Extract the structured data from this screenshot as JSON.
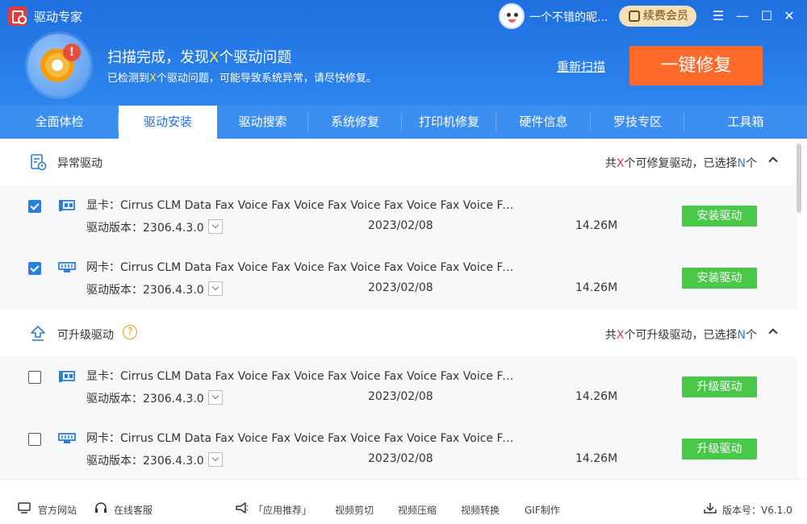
{
  "app": {
    "title": "驱动专家"
  },
  "user": {
    "name": "一个不错的昵...",
    "renew_label": "续费会员"
  },
  "window_controls": {
    "menu": "☰",
    "minimize": "—",
    "maximize": "☐",
    "close": "✕"
  },
  "scan": {
    "title_pre": "扫描完成，发现",
    "title_count": "X",
    "title_post": "个驱动问题",
    "sub_pre": "已检测到",
    "sub_count": "X",
    "sub_post": "个驱动问题，可能导致系统异常，请尽快修复。",
    "rescan_label": "重新扫描",
    "fix_label": "一键修复"
  },
  "tabs": [
    {
      "label": "全面体检"
    },
    {
      "label": "驱动安装"
    },
    {
      "label": "驱动搜索"
    },
    {
      "label": "系统修复"
    },
    {
      "label": "打印机修复"
    },
    {
      "label": "硬件信息"
    },
    {
      "label": "罗技专区"
    },
    {
      "label": "工具箱"
    }
  ],
  "sections": {
    "abnormal": {
      "title": "异常驱动",
      "summary_pre": "共",
      "summary_count": "X",
      "summary_mid": "个可修复驱动，已选择",
      "summary_sel": "N",
      "summary_post": "个",
      "rows": [
        {
          "name": "显卡：Cirrus CLM Data Fax Voice Fax Voice Fax Voice Fax Voice Fax Voice Fax Voice Fax Voice",
          "version": "驱动版本：2306.4.3.0",
          "date": "2023/02/08",
          "size": "14.26M",
          "action": "安装驱动",
          "checked": true,
          "icon": "display-card-icon"
        },
        {
          "name": "网卡：Cirrus CLM Data Fax Voice Fax Voice Fax Voice Fax Voice Fax Voice Fax Voice Fax Voice",
          "version": "驱动版本：2306.4.3.0",
          "date": "2023/02/08",
          "size": "14.26M",
          "action": "安装驱动",
          "checked": true,
          "icon": "network-card-icon"
        }
      ]
    },
    "upgrade": {
      "title": "可升级驱动",
      "summary_pre": "共",
      "summary_count": "X",
      "summary_mid": "个可升级驱动，已选择",
      "summary_sel": "N",
      "summary_post": "个",
      "rows": [
        {
          "name": "显卡：Cirrus CLM Data Fax Voice Fax Voice Fax Voice Fax Voice Fax Voice Fax Voice Fax Voice",
          "version": "驱动版本：2306.4.3.0",
          "date": "2023/02/08",
          "size": "14.26M",
          "action": "升级驱动",
          "checked": false,
          "icon": "display-card-icon"
        },
        {
          "name": "网卡：Cirrus CLM Data Fax Voice Fax Voice Fax Voice Fax Voice Fax Voice Fax Voice Fax Voice",
          "version": "驱动版本：2306.4.3.0",
          "date": "2023/02/08",
          "size": "14.26M",
          "action": "升级驱动",
          "checked": false,
          "icon": "network-card-icon"
        }
      ]
    }
  },
  "footer": {
    "official_site": "官方网站",
    "support": "在线客服",
    "app_recommend": "「应用推荐」",
    "video_edit": "视频剪切",
    "video_compress": "视频压缩",
    "video_convert": "视频转换",
    "gif_make": "GIF制作",
    "version": "版本号：V6.1.0"
  },
  "colors": {
    "header": "#2d86ee",
    "fix_button": "#ff6a2b",
    "action_button": "#49c749",
    "highlight": "#ffe34d",
    "accent": "#2a7de1"
  }
}
